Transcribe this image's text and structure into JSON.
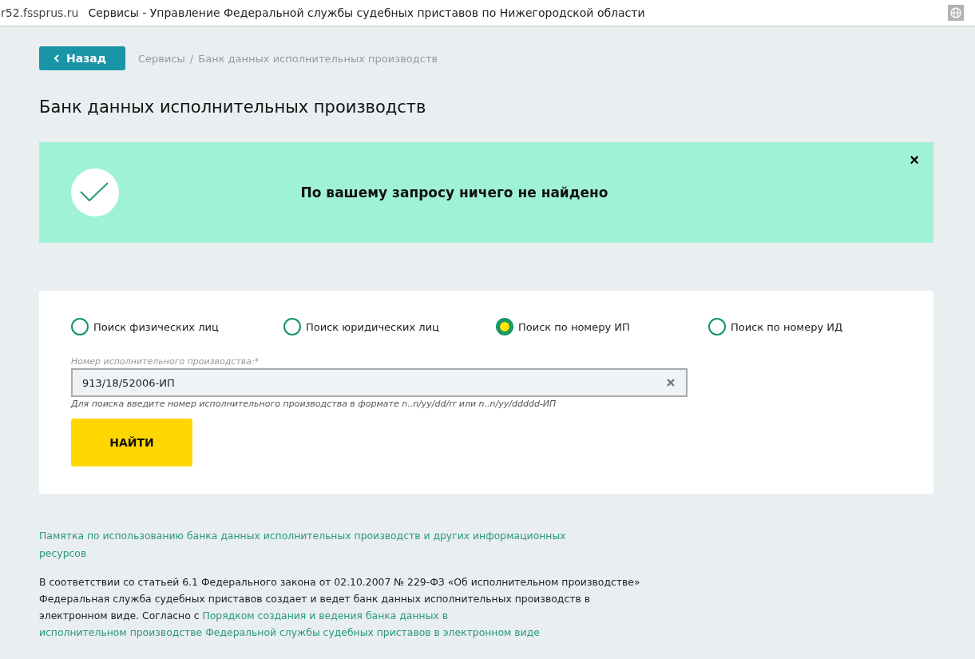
{
  "address_bar": {
    "domain": "r52.fssprus.ru",
    "title": "Сервисы - Управление Федеральной службы судебных приставов по Нижегородской области"
  },
  "back_button": "Назад",
  "breadcrumbs": [
    "Сервисы",
    "Банк данных исполнительных производств"
  ],
  "breadcrumb_separator": "/",
  "page_title": "Банк данных исполнительных производств",
  "alert": {
    "message": "По вашему запросу ничего не найдено",
    "close": "×"
  },
  "search_modes": [
    {
      "label": "Поиск физических лиц",
      "selected": false
    },
    {
      "label": "Поиск юридических лиц",
      "selected": false
    },
    {
      "label": "Поиск по номеру ИП",
      "selected": true
    },
    {
      "label": "Поиск по номеру ИД",
      "selected": false
    }
  ],
  "field": {
    "label": "Номер исполнительного производства:*",
    "value": "913/18/52006-ИП",
    "hint": "Для поиска введите номер исполнительного производства в формате n..n/yy/dd/rr или n..n/yy/ddddd-ИП"
  },
  "submit_button": "НАЙТИ",
  "memo_link": "Памятка по использованию банка данных исполнительных производств и других информационных ресурсов",
  "info": {
    "text": "В соответствии со статьей 6.1 Федерального закона от 02.10.2007 № 229-ФЗ «Об исполнительном производстве» Федеральная служба судебных приставов создает и ведет банк данных исполнительных производств в электронном виде. Согласно с",
    "link_lines": [
      "Порядком создания и ведения банка данных в",
      "исполнительном производстве Федеральной службы судебных приставов в электронном виде"
    ]
  }
}
